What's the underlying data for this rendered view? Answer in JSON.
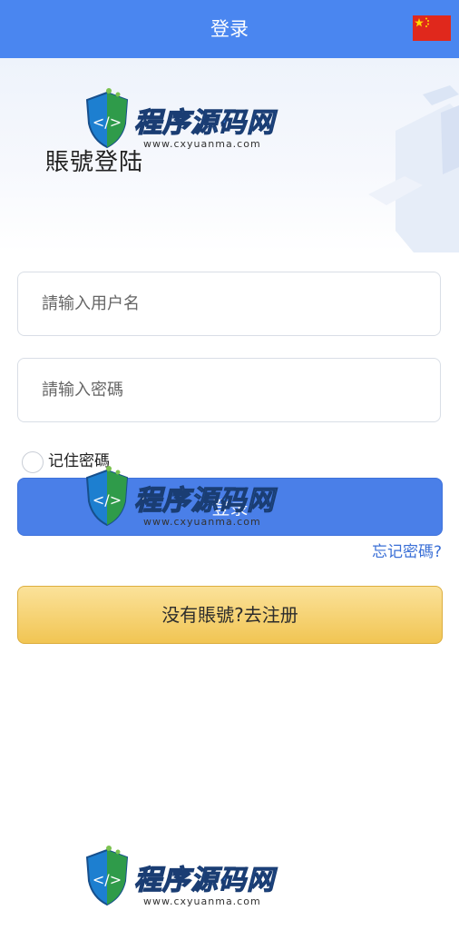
{
  "header": {
    "title": "登录",
    "flag_icon": "china-flag-icon",
    "bg_color": "#4a86f0"
  },
  "hero": {
    "title": "賬號登陆"
  },
  "form": {
    "username_placeholder": "請输入用户名",
    "password_placeholder": "請输入密碼",
    "remember_label": "记住密碼",
    "login_label": "登录",
    "forgot_label": "忘记密碼?",
    "register_label": "没有賬號?去注册"
  },
  "watermark": {
    "part_a": "程序",
    "part_b": "源码网",
    "url": "www.cxyuanma.com"
  }
}
